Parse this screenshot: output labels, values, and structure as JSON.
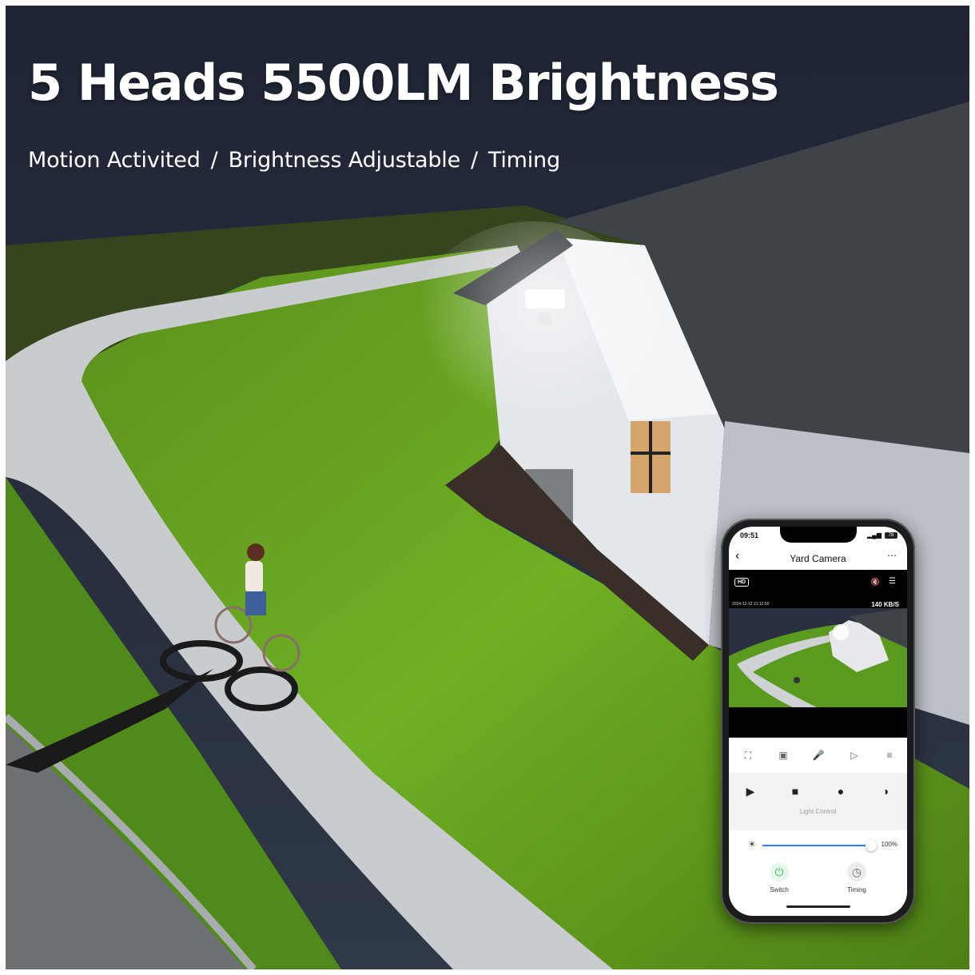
{
  "banner": {
    "headline": "5 Heads 5500LM Brightness",
    "features": [
      "Motion Activited",
      "Brightness Adjustable",
      "Timing"
    ],
    "separator": "/"
  },
  "phone": {
    "status_time": "09:51",
    "battery": "78",
    "nav": {
      "title": "Yard Camera",
      "back_icon": "chevron-left-icon",
      "more_icon": "more-dots-icon"
    },
    "video": {
      "quality_badge": "HD",
      "timestamp": "2024-12-12 21:12:50",
      "bitrate": "140 KB/S"
    },
    "controls": [
      "fullscreen-icon",
      "snapshot-icon",
      "microphone-icon",
      "record-icon",
      "menu-icon"
    ],
    "tabs": [
      "playback-icon",
      "gallery-icon",
      "palette-icon",
      "shield-icon"
    ],
    "light_control_label": "Light Control",
    "brightness": {
      "value": 100,
      "label": "100%"
    },
    "switch_label": "Switch",
    "timing_label": "Timing",
    "accent_color": "#2d7ff3",
    "switch_color": "#39c45a"
  }
}
